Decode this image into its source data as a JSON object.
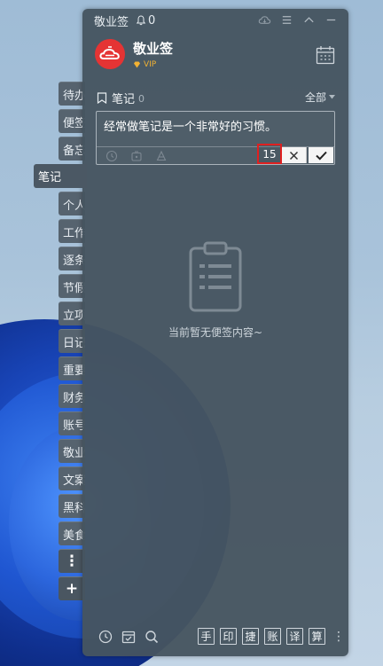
{
  "app": {
    "title": "敬业签",
    "bell_count": "0"
  },
  "profile": {
    "name": "敬业签",
    "badge": "VIP"
  },
  "tabs": [
    {
      "label": "待办"
    },
    {
      "label": "便签"
    },
    {
      "label": "备忘"
    },
    {
      "label": "笔记",
      "active": true
    },
    {
      "label": "个人"
    },
    {
      "label": "工作"
    },
    {
      "label": "逐条"
    },
    {
      "label": "节假"
    },
    {
      "label": "立项"
    },
    {
      "label": "日记"
    },
    {
      "label": "重要"
    },
    {
      "label": "财务"
    },
    {
      "label": "账号"
    },
    {
      "label": "敬业"
    },
    {
      "label": "文案"
    },
    {
      "label": "黑科"
    },
    {
      "label": "美食"
    }
  ],
  "more_symbol": "⋮",
  "add_symbol": "+",
  "notes": {
    "title": "笔记",
    "count": "0",
    "filter": "全部"
  },
  "editor": {
    "text": "经常做笔记是一个非常好的习惯。",
    "char_count": "15",
    "cancel": "✕",
    "confirm": "✔"
  },
  "empty": {
    "message": "当前暂无便签内容~"
  },
  "bottom": {
    "tools": [
      "手",
      "印",
      "捷",
      "账",
      "译",
      "算"
    ],
    "more": "⋮"
  },
  "colors": {
    "accent_red": "#e53434",
    "vip_gold": "#f2b233",
    "panel": "#465460"
  }
}
